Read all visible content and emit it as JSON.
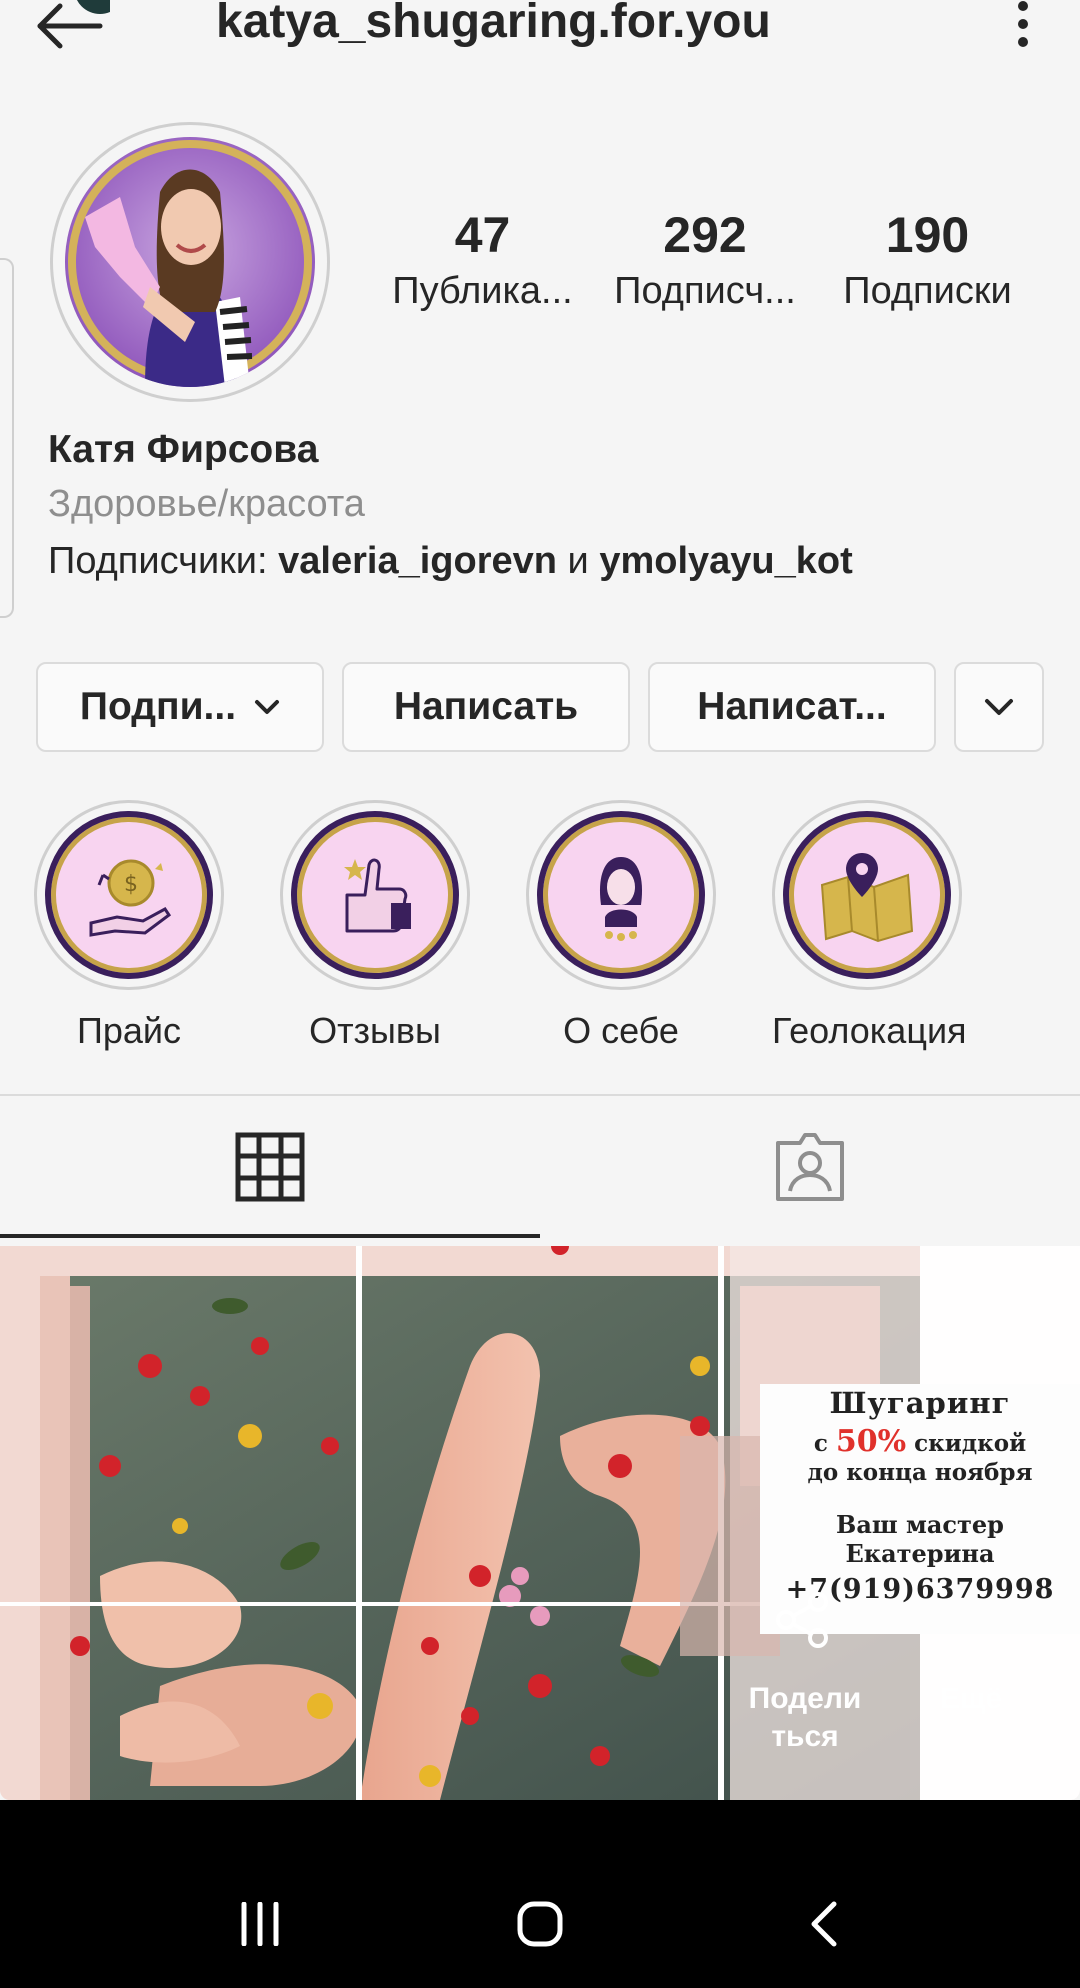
{
  "header": {
    "title": "katya_shugaring.for.you"
  },
  "profile": {
    "stats": [
      {
        "value": "47",
        "label": "Публика..."
      },
      {
        "value": "292",
        "label": "Подписч..."
      },
      {
        "value": "190",
        "label": "Подписки"
      }
    ],
    "name": "Катя Фирсова",
    "category": "Здоровье/красота",
    "followers_prefix": "Подписчики: ",
    "follower_1": "valeria_igorevn",
    "followers_joiner": " и ",
    "follower_2": "ymolyayu_kot"
  },
  "actions": {
    "follow_label": "Подпи...",
    "message_label": "Написать",
    "email_label": "Написат..."
  },
  "highlights": [
    {
      "label": "Прайс",
      "icon": "coin-hand-icon"
    },
    {
      "label": "Отзывы",
      "icon": "thumbs-up-icon"
    },
    {
      "label": "О себе",
      "icon": "woman-portrait-icon"
    },
    {
      "label": "Геолокация",
      "icon": "map-pin-icon"
    }
  ],
  "post": {
    "line1": "Шугаринг",
    "line2_pre": "с ",
    "line2_pct": "50%",
    "line2_post": " скидкой",
    "line3": "до конца ноября",
    "line4": "Ваш мастер",
    "line5": "Екатерина",
    "line6": "+7(919)6379998",
    "share_label": "Подели\nться",
    "more_label": "Ещё"
  },
  "colors": {
    "accent_purple": "#3a1f5c",
    "highlight_fill": "#f8d4f0",
    "gold": "#c6a349",
    "promo_red": "#e0312b"
  }
}
